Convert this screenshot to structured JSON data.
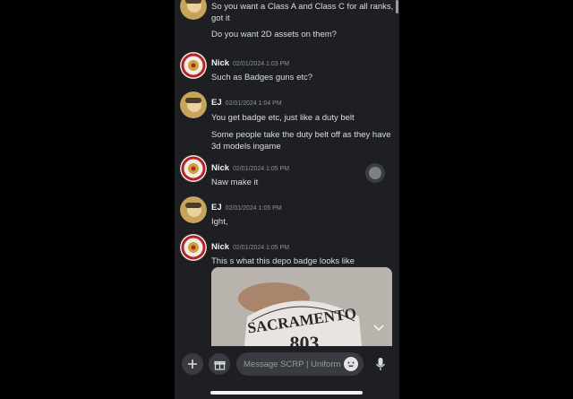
{
  "messages": [
    {
      "author": "",
      "time": "",
      "lines": [
        "So you want a Class A and Class C for all ranks, got it",
        "Do you want 2D assets on them?"
      ]
    },
    {
      "author": "Nick",
      "time": "02/01/2024 1:03 PM",
      "lines": [
        "Such as Badges guns etc?"
      ]
    },
    {
      "author": "EJ",
      "time": "02/01/2024 1:04 PM",
      "lines": [
        "You get badge etc, just like a duty belt",
        "Some people take the duty belt off as they have 3d models ingame"
      ]
    },
    {
      "author": "Nick",
      "time": "02/01/2024 1:05 PM",
      "lines": [
        "Naw make it"
      ]
    },
    {
      "author": "EJ",
      "time": "02/01/2024 1:05 PM",
      "lines": [
        "Ight,"
      ]
    },
    {
      "author": "Nick",
      "time": "02/01/2024 1:05 PM",
      "lines": [
        "This s what this depo badge looks like"
      ]
    }
  ],
  "attachment": {
    "badge_top": "SACRAMENTO",
    "badge_number": "803"
  },
  "composer": {
    "placeholder": "Message SCRP | Uniform"
  },
  "icons": {
    "add": "plus-icon",
    "gift": "gift-icon",
    "emoji": "emoji-icon",
    "mic": "microphone-icon",
    "expand": "chevron-down-icon"
  }
}
